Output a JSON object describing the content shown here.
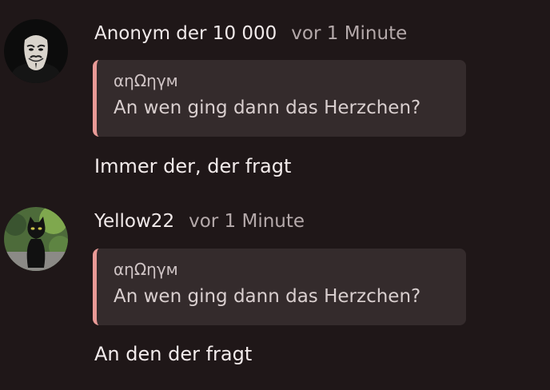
{
  "comments": [
    {
      "username": "Anonym der 10 000",
      "timestamp": "vor 1 Minute",
      "avatar_icon": "masked-face-avatar",
      "quote": {
        "author": "αηΩηγм",
        "text": "An wen ging dann das Herzchen?"
      },
      "body": "Immer der, der fragt"
    },
    {
      "username": "Yellow22",
      "timestamp": "vor 1 Minute",
      "avatar_icon": "black-cat-avatar",
      "quote": {
        "author": "αηΩηγм",
        "text": "An wen ging dann das Herzchen?"
      },
      "body": "An den der fragt"
    }
  ],
  "colors": {
    "background": "#1f1718",
    "quote_background": "#342b2c",
    "quote_accent": "#e99a97",
    "timestamp": "#b4a9aa"
  }
}
